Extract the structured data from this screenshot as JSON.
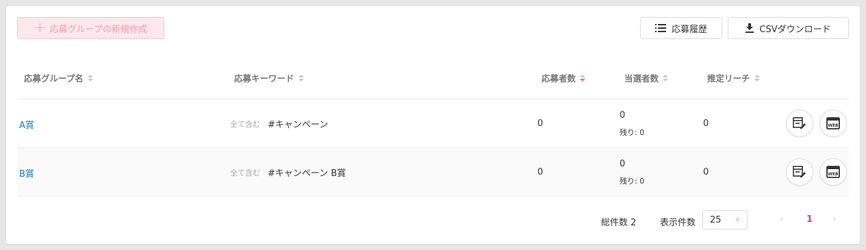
{
  "toolbar": {
    "new_group_label": "応募グループの新規作成",
    "history_label": "応募履歴",
    "csv_label": "CSVダウンロード"
  },
  "table": {
    "headers": {
      "group_name": "応募グループ名",
      "keyword": "応募キーワード",
      "applicants": "応募者数",
      "winners": "当選者数",
      "reach": "推定リーチ"
    },
    "rows": [
      {
        "name": "A賞",
        "keyword_condition": "全て含む",
        "keyword": "#キャンペーン",
        "applicants": "0",
        "winners": "0",
        "remaining": "残り: 0",
        "reach": "0"
      },
      {
        "name": "B賞",
        "keyword_condition": "全て含む",
        "keyword": "#キャンペーン B賞",
        "applicants": "0",
        "winners": "0",
        "remaining": "残り: 0",
        "reach": "0"
      }
    ]
  },
  "footer": {
    "total_label": "総件数 2",
    "per_page_label": "表示件数",
    "per_page_value": "25",
    "current_page": "1",
    "prev_symbol": "‹",
    "next_symbol": "›"
  },
  "colors": {
    "accent": "#d6456a",
    "link": "#1a7ab8",
    "new_button_bg": "#fde9ed"
  }
}
